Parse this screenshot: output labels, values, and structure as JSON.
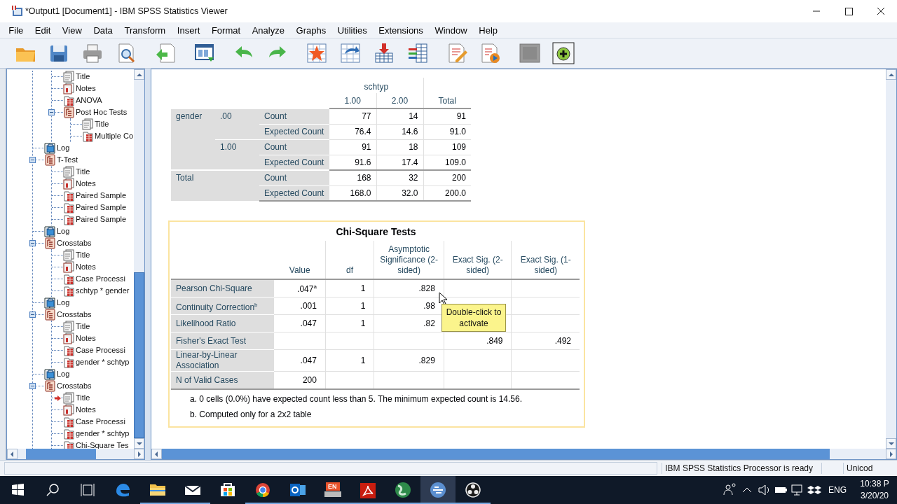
{
  "window": {
    "title": "*Output1 [Document1] - IBM SPSS Statistics Viewer"
  },
  "menu": [
    {
      "label": "File"
    },
    {
      "label": "Edit"
    },
    {
      "label": "View"
    },
    {
      "label": "Data"
    },
    {
      "label": "Transform"
    },
    {
      "label": "Insert"
    },
    {
      "label": "Format"
    },
    {
      "label": "Analyze"
    },
    {
      "label": "Graphs"
    },
    {
      "label": "Utilities"
    },
    {
      "label": "Extensions"
    },
    {
      "label": "Window"
    },
    {
      "label": "Help"
    }
  ],
  "outline": [
    {
      "children": [
        {
          "label": "Title",
          "kind": "title"
        },
        {
          "label": "Notes",
          "kind": "notes"
        },
        {
          "label": "ANOVA",
          "kind": "table"
        },
        {
          "label": "Post Hoc Tests",
          "kind": "heading",
          "expanded": true,
          "children": [
            {
              "label": "Title",
              "kind": "title"
            },
            {
              "label": "Multiple Co",
              "kind": "table"
            }
          ]
        }
      ]
    },
    {
      "label": "Log",
      "kind": "log"
    },
    {
      "label": "T-Test",
      "kind": "heading",
      "expanded": true,
      "children": [
        {
          "label": "Title",
          "kind": "title"
        },
        {
          "label": "Notes",
          "kind": "notes"
        },
        {
          "label": "Paired Sample",
          "kind": "table"
        },
        {
          "label": "Paired Sample",
          "kind": "table"
        },
        {
          "label": "Paired Sample",
          "kind": "table"
        }
      ]
    },
    {
      "label": "Log",
      "kind": "log"
    },
    {
      "label": "Crosstabs",
      "kind": "heading",
      "expanded": true,
      "children": [
        {
          "label": "Title",
          "kind": "title"
        },
        {
          "label": "Notes",
          "kind": "notes"
        },
        {
          "label": "Case Processi",
          "kind": "table"
        },
        {
          "label": "schtyp * gender",
          "kind": "table"
        }
      ]
    },
    {
      "label": "Log",
      "kind": "log"
    },
    {
      "label": "Crosstabs",
      "kind": "heading",
      "expanded": true,
      "children": [
        {
          "label": "Title",
          "kind": "title"
        },
        {
          "label": "Notes",
          "kind": "notes"
        },
        {
          "label": "Case Processi",
          "kind": "table"
        },
        {
          "label": "gender * schtyp",
          "kind": "table"
        }
      ]
    },
    {
      "label": "Log",
      "kind": "log"
    },
    {
      "label": "Crosstabs",
      "kind": "heading",
      "expanded": true,
      "children": [
        {
          "label": "Title",
          "kind": "title",
          "current": true
        },
        {
          "label": "Notes",
          "kind": "notes"
        },
        {
          "label": "Case Processi",
          "kind": "table"
        },
        {
          "label": "gender * schtyp",
          "kind": "table"
        },
        {
          "label": "Chi-Square Tes",
          "kind": "table"
        }
      ]
    }
  ],
  "crosstab": {
    "column_variable": "schtyp",
    "columns": [
      "1.00",
      "2.00"
    ],
    "total_column": "Total",
    "row_groups": [
      {
        "label": "gender",
        "subgroups": [
          {
            "label": ".00",
            "rows": [
              {
                "statistic": "Count",
                "values": [
                  "77",
                  "14",
                  "91"
                ]
              },
              {
                "statistic": "Expected Count",
                "values": [
                  "76.4",
                  "14.6",
                  "91.0"
                ]
              }
            ]
          },
          {
            "label": "1.00",
            "rows": [
              {
                "statistic": "Count",
                "values": [
                  "91",
                  "18",
                  "109"
                ]
              },
              {
                "statistic": "Expected Count",
                "values": [
                  "91.6",
                  "17.4",
                  "109.0"
                ]
              }
            ]
          }
        ]
      },
      {
        "label": "Total",
        "subgroups": [
          {
            "rows": [
              {
                "statistic": "Count",
                "values": [
                  "168",
                  "32",
                  "200"
                ]
              },
              {
                "statistic": "Expected Count",
                "values": [
                  "168.0",
                  "32.0",
                  "200.0"
                ]
              }
            ]
          }
        ]
      }
    ]
  },
  "chi_square": {
    "title": "Chi-Square Tests",
    "columns": [
      "Value",
      "df",
      "Asymptotic Significance (2-sided)",
      "Exact Sig. (2-sided)",
      "Exact Sig. (1-sided)"
    ],
    "rows": [
      {
        "label": "Pearson Chi-Square",
        "value": ".047$^{a}$",
        "df": "1",
        "asymptotic_significance": ".828"
      },
      {
        "label": "Continuity Correction$^{b}$",
        "value": ".001",
        "df": "1",
        "asymptotic_significance": ".98"
      },
      {
        "label": "Likelihood Ratio",
        "value": ".047",
        "df": "1",
        "asymptotic_significance": ".82"
      },
      {
        "label": "Fisher's Exact Test",
        "exact_sig_2_sided": ".849",
        "exact_sig_1_sided": ".492"
      },
      {
        "label": "Linear-by-Linear Association",
        "value": ".047",
        "df": "1",
        "asymptotic_significance": ".829"
      },
      {
        "label": "N of Valid Cases",
        "value": "200"
      }
    ],
    "footnotes": [
      "a. 0 cells (0.0%) have expected count less than 5. The minimum expected count is 14.56.",
      "b. Computed only for a 2x2 table"
    ],
    "tooltip": "Double-click to activate"
  },
  "status_bar": [
    "IBM SPSS Statistics Processor is ready",
    "Unicod"
  ],
  "taskbar": {
    "apps": [
      {
        "kind": "edge",
        "running": false,
        "selected": false
      },
      {
        "kind": "explorer",
        "running": true,
        "selected": false
      },
      {
        "kind": "mail",
        "running": true,
        "selected": false
      },
      {
        "kind": "store",
        "running": false,
        "selected": false
      },
      {
        "kind": "chrome",
        "running": true,
        "selected": false
      },
      {
        "kind": "outlook",
        "running": true,
        "selected": false
      },
      {
        "kind": "keyboard",
        "running": true,
        "selected": false,
        "label": "EN"
      },
      {
        "kind": "acrobat",
        "running": true,
        "selected": false
      },
      {
        "kind": "globe",
        "running": true,
        "selected": false
      },
      {
        "kind": "spss",
        "running": true,
        "selected": true
      },
      {
        "kind": "obs",
        "running": true,
        "selected": false
      }
    ],
    "language": "ENG",
    "time": "10:38 P",
    "date": "3/20/20"
  }
}
